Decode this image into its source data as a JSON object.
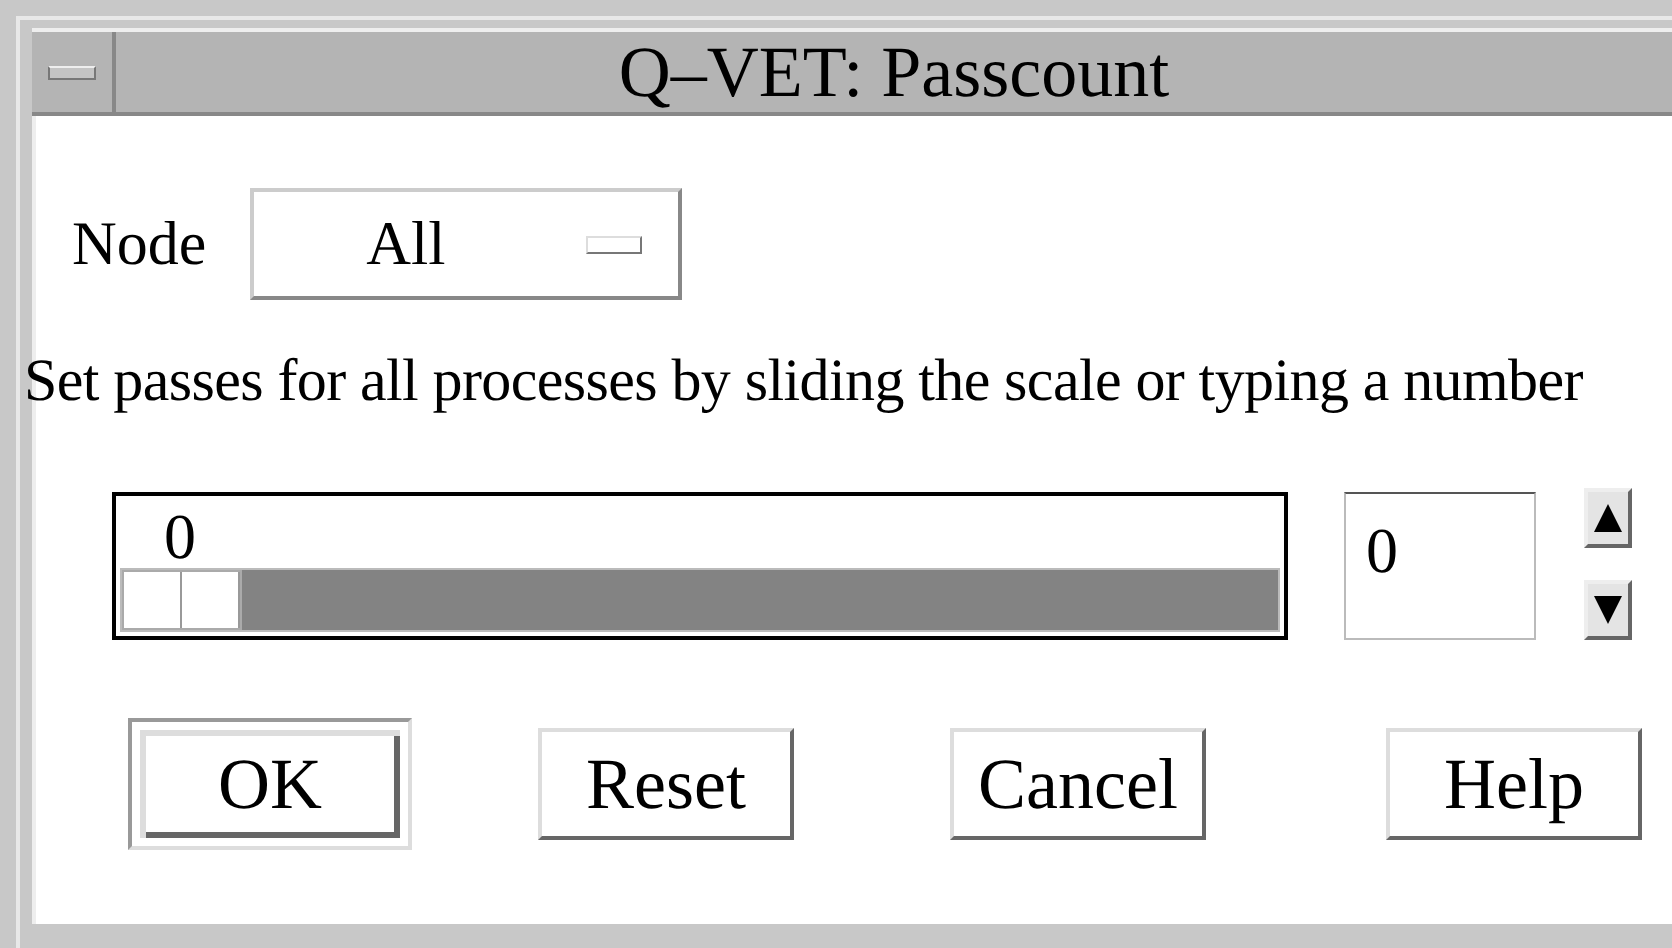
{
  "window": {
    "title": "Q–VET: Passcount"
  },
  "node": {
    "label": "Node",
    "value": "All"
  },
  "instruction": "Set passes for all processes by sliding the scale or typing a number",
  "scale": {
    "value_label": "0",
    "level": 0
  },
  "passes_field": {
    "value": "0"
  },
  "buttons": [
    {
      "label": "OK",
      "default": true
    },
    {
      "label": "Reset",
      "default": false
    },
    {
      "label": "Cancel",
      "default": false
    },
    {
      "label": "Help",
      "default": false
    }
  ]
}
